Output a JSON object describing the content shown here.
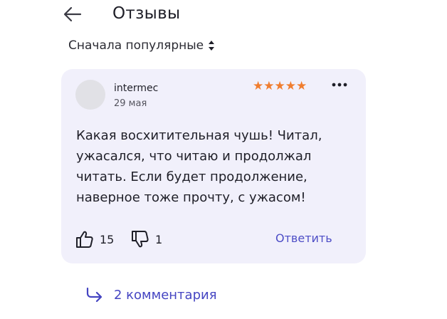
{
  "header": {
    "title": "Отзывы",
    "back_icon": "arrow-left-icon"
  },
  "sort": {
    "label": "Сначала популярные",
    "icon": "sort-updown-icon"
  },
  "review": {
    "author": "intermec",
    "date": "29 мая",
    "rating": 5,
    "rating_max": 5,
    "rating_color": "#f07d2f",
    "stars_text": "★★★★★",
    "more_icon": "more-horizontal-icon",
    "text": "Какая восхитительная чушь! Читал, ужасался, что читаю и продолжал читать. Если будет продолжение, наверное тоже прочту, с ужасом!",
    "likes": "15",
    "dislikes": "1",
    "reply_label": "Ответить",
    "card_color": "#f1f0fb"
  },
  "comments": {
    "label": "2 комментария",
    "icon": "reply-arrow-icon",
    "accent_color": "#4545c2"
  }
}
